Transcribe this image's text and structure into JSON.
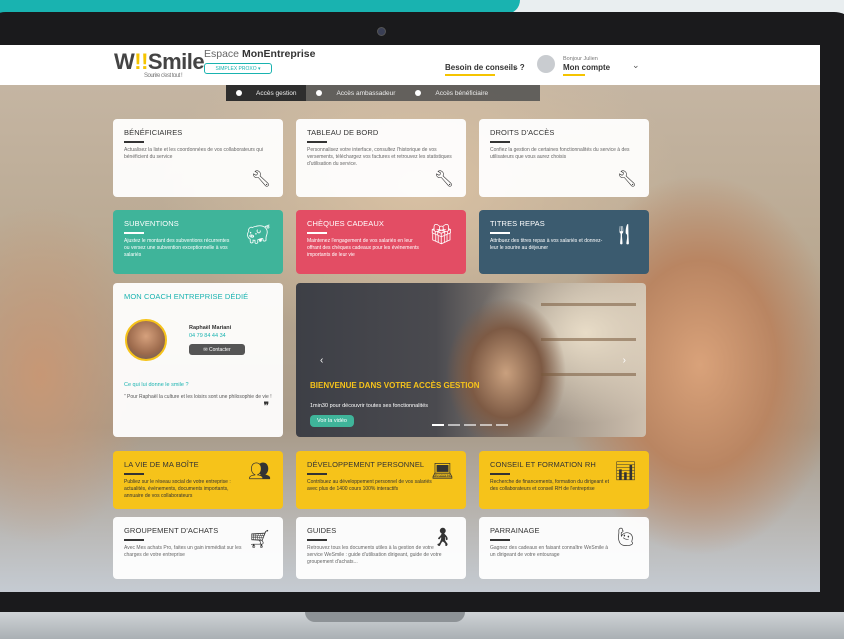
{
  "brand": {
    "logo": "W",
    "logo_accent": "!!",
    "logo_rest": "Smile",
    "tagline": "Sourire c'est tout !",
    "espace_prefix": "Espace",
    "espace_name": "MonEntreprise",
    "plan": "SIMPLEX PROXO"
  },
  "header": {
    "conseils": "Besoin de conseils ?",
    "bonjour": "Bonjour Julien",
    "compte": "Mon compte"
  },
  "access_tabs": [
    {
      "label": "Accès gestion"
    },
    {
      "label": "Accès ambassadeur"
    },
    {
      "label": "Accès bénéficiaire"
    }
  ],
  "cards": {
    "beneficiaires": {
      "title": "BÉNÉFICIAIRES",
      "text": "Actualisez la liste et les coordonnées de vos collaborateurs qui bénéficient du service"
    },
    "tableau": {
      "title": "TABLEAU DE BORD",
      "text": "Personnalisez votre interface, consultez l'historique de vos versements, téléchargez vos factures et retrouvez les statistiques d'utilisation du service."
    },
    "droits": {
      "title": "DROITS D'ACCÈS",
      "text": "Confiez la gestion de certaines fonctionnalités du service à des utilisateurs que vous aurez choisis"
    },
    "subventions": {
      "title": "SUBVENTIONS",
      "text": "Ajustez le montant des subventions récurrentes ou versez une subvention exceptionnelle à vos salariés"
    },
    "cheques": {
      "title": "CHÈQUES CADEAUX",
      "text": "Maintenez l'engagement de vos salariés en leur offrant des chèques cadeaux pour les événements importants de leur vie"
    },
    "titres": {
      "title": "TITRES REPAS",
      "text": "Attribuez des titres repas à vos salariés et donnez-leur le sourire au déjeuner"
    },
    "vie": {
      "title": "LA VIE DE MA BOÎTE",
      "text": "Publiez sur le réseau social de votre entreprise : actualités, événements, documents importants, annuaire de vos collaborateurs"
    },
    "dev": {
      "title": "DÉVELOPPEMENT PERSONNEL",
      "text": "Contribuez au développement personnel de vos salariés avec plus de 1400 cours 100% interactifs"
    },
    "conseil": {
      "title": "CONSEIL ET FORMATION RH",
      "text": "Recherche de financements, formation du dirigeant et des collaborateurs et conseil RH de l'entreprise"
    },
    "groupement": {
      "title": "GROUPEMENT D'ACHATS",
      "text": "Avec Mes achats Pro, faites un gain immédiat sur les charges de votre entreprise"
    },
    "guides": {
      "title": "GUIDES",
      "text": "Retrouvez tous les documents utiles à la gestion de votre service WeSmile : guide d'utilisation dirigeant, guide de votre groupement d'achats..."
    },
    "parrainage": {
      "title": "PARRAINAGE",
      "text": "Gagnez des cadeaux en faisant connaître WeSmile à un dirigeant de votre entourage"
    }
  },
  "coach": {
    "title": "MON COACH ENTREPRISE DÉDIÉ",
    "name": "Raphaël Mariani",
    "phone": "04 79 84 44 34",
    "button": "Contacter",
    "question": "Ce qui lui donne le smile ?",
    "quote": "“ Pour Raphaël la culture et les loisirs sont une philosophie de vie !"
  },
  "hero": {
    "title": "BIENVENUE DANS VOTRE ACCÈS GESTION",
    "subtitle": "1min30 pour découvrir toutes ses fonctionnalités",
    "button": "Voir la vidéo"
  }
}
